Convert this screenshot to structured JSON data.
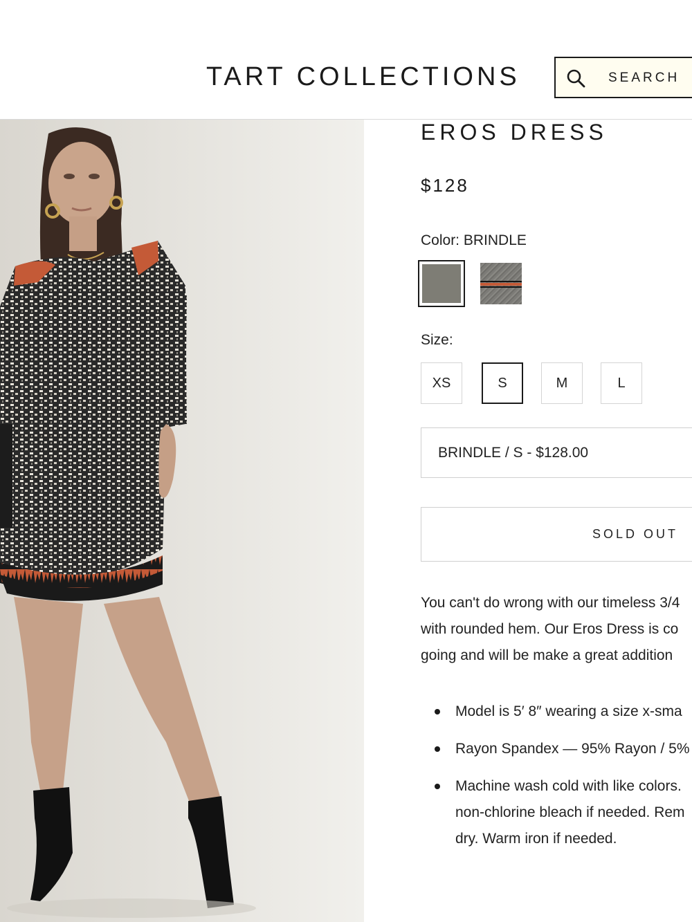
{
  "header": {
    "logo": "TART COLLECTIONS",
    "search_label": "SEARCH",
    "search_icon": "search-icon"
  },
  "product": {
    "image_alt": "Model wearing Eros Dress",
    "title": "EROS DRESS",
    "price": "$128",
    "color_label": "Color: BRINDLE",
    "swatches": [
      {
        "name": "BRINDLE",
        "selected": true,
        "color": "#7e7d75"
      },
      {
        "name": "Pattern",
        "selected": false,
        "color": "#7c7b77"
      }
    ],
    "size_label": "Size:",
    "sizes": [
      {
        "label": "XS",
        "selected": false
      },
      {
        "label": "S",
        "selected": true
      },
      {
        "label": "M",
        "selected": false
      },
      {
        "label": "L",
        "selected": false
      }
    ],
    "variant_value": "BRINDLE / S - $128.00",
    "button_label": "SOLD OUT",
    "description": [
      "You can't do wrong with our timeless 3/4",
      "with rounded hem. Our Eros Dress is co",
      "going and will be make a great addition"
    ],
    "bullets": [
      {
        "lines": [
          "Model is 5′ 8″ wearing a size x-sma"
        ]
      },
      {
        "lines": [
          "Rayon Spandex — 95% Rayon / 5%"
        ]
      },
      {
        "lines": [
          "Machine wash cold with like colors.",
          "non-chlorine bleach if needed. Rem",
          "dry. Warm iron if needed."
        ]
      }
    ]
  },
  "colors": {
    "accent_orange": "#c45a37",
    "text": "#1a1a1a",
    "border": "#cfcfcf"
  }
}
